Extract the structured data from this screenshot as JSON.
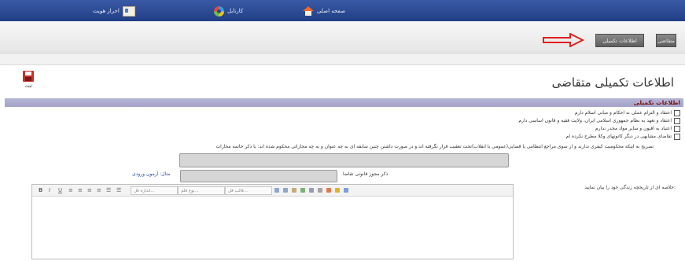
{
  "nav": {
    "home": "صفحه اصلی",
    "cartable": "کارتابل",
    "auth": "احراز هویت"
  },
  "tabs": {
    "applicant": "متقاضی",
    "extra": "اطلاعات تکمیلی"
  },
  "page": {
    "title": "اطلاعات تکمیلی متقاضی",
    "save_label": "ثبت"
  },
  "section": {
    "title": "اطلاعات تکمیلی",
    "checks": [
      "اعتقاد و التزام عملی به احکام و مبانی اسلام دارم",
      "اعتقاد و تعهد به نظام جمهوری اسلامی ایران، ولایت فقیه و قانون اساسی دارم",
      "اعتیاد به افیون و سایر مواد مخدر ندارم",
      "تقاضای مشابهی در دیگر کانونهای وکلا مطرح نکرده ام"
    ],
    "note": "تصریح به اینکه محکومیت کیفری ندارند و از سوی مراجع انتظامی یا قضایی(عمومی یا انقلاب)تحت تعقیب قرار نگرفته اند و در صورت داشتن چنین سابقه ای به چه عنوان و به چه مجازاتی محکوم شده اند: با ذکر خاتمه مجازات",
    "license_label": "ذکر مجوز قانونی تقاضا",
    "example_link": "مثال: آزمون ورودی",
    "summary_label": "خلاصه ای از تاریخچه زندگی خود را بیان نمایید:"
  },
  "editor": {
    "bold": "B",
    "italic": "I",
    "underline": "U",
    "size_select": "اندازه قل...",
    "font_select": "نوع قلم...",
    "format_select": "قالب قل..."
  }
}
